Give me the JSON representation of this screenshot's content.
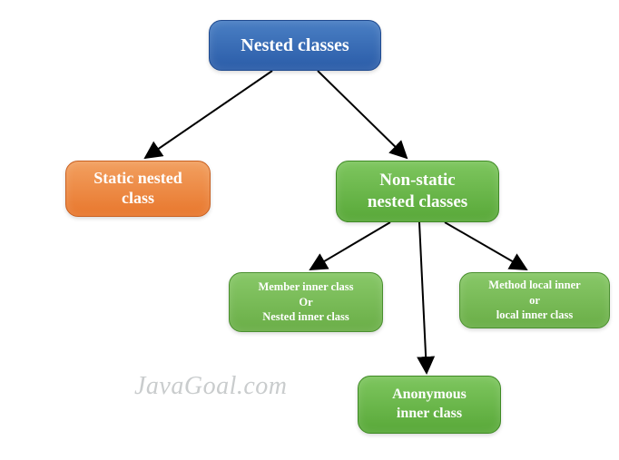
{
  "nodes": {
    "root": {
      "label": "Nested classes"
    },
    "static": {
      "line1": "Static nested",
      "line2": "class"
    },
    "nonstatic": {
      "line1": "Non-static",
      "line2": "nested classes"
    },
    "member": {
      "line1": "Member inner class",
      "line2": "Or",
      "line3": "Nested inner class"
    },
    "method": {
      "line1": "Method local inner",
      "line2": "or",
      "line3": "local inner class"
    },
    "anon": {
      "line1": "Anonymous",
      "line2": "inner class"
    }
  },
  "watermark": "JavaGoal.com",
  "colors": {
    "root": "#2a5ca8",
    "static": "#e8772d",
    "nonstatic": "#58a838",
    "leaf": "#6aae47"
  },
  "edges": [
    {
      "from": "root",
      "to": "static"
    },
    {
      "from": "root",
      "to": "nonstatic"
    },
    {
      "from": "nonstatic",
      "to": "member"
    },
    {
      "from": "nonstatic",
      "to": "method"
    },
    {
      "from": "nonstatic",
      "to": "anon"
    }
  ]
}
